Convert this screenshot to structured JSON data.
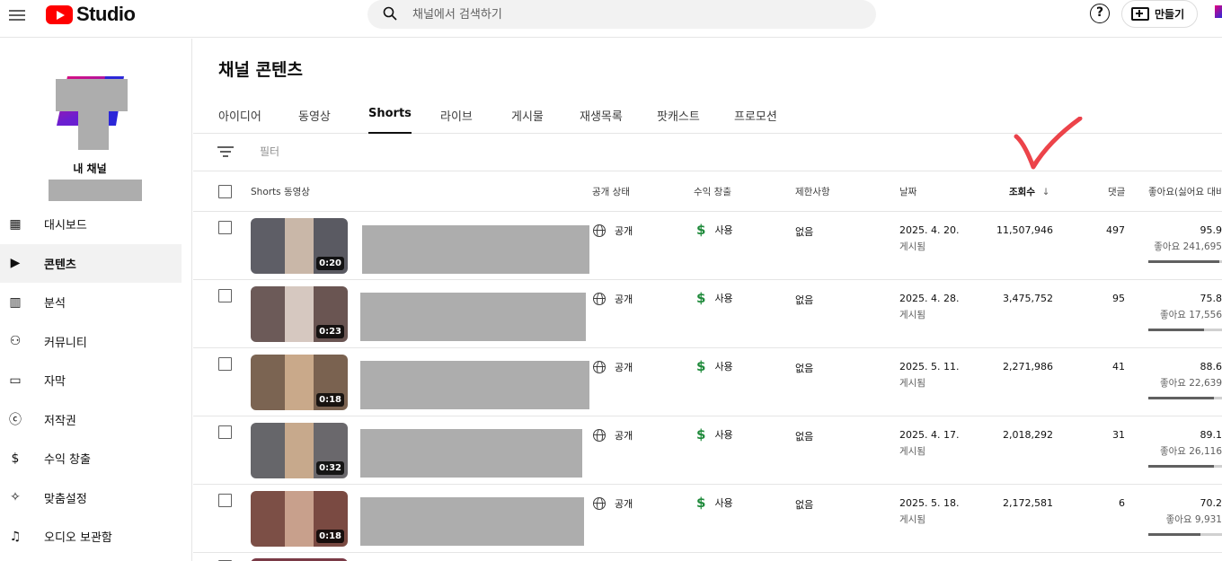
{
  "topbar": {
    "logo_text": "Studio",
    "search_placeholder": "채널에서 검색하기",
    "help_label": "?",
    "create_label": "만들기"
  },
  "sidebar": {
    "channel_label": "내 채널",
    "items": [
      {
        "label": "대시보드",
        "icon": "dashboard-icon",
        "glyph": "▦"
      },
      {
        "label": "콘텐츠",
        "icon": "content-icon",
        "glyph": "▶",
        "active": true
      },
      {
        "label": "분석",
        "icon": "analytics-icon",
        "glyph": "▥"
      },
      {
        "label": "커뮤니티",
        "icon": "community-icon",
        "glyph": "⚇"
      },
      {
        "label": "자막",
        "icon": "subtitles-icon",
        "glyph": "▭"
      },
      {
        "label": "저작권",
        "icon": "copyright-icon",
        "glyph": "ⓒ"
      },
      {
        "label": "수익 창출",
        "icon": "monetization-icon",
        "glyph": "$"
      },
      {
        "label": "맞춤설정",
        "icon": "customization-icon",
        "glyph": "✧"
      },
      {
        "label": "오디오 보관함",
        "icon": "audio-library-icon",
        "glyph": "♫"
      }
    ]
  },
  "main": {
    "title": "채널 콘텐츠",
    "tabs": [
      "아이디어",
      "동영상",
      "Shorts",
      "라이브",
      "게시물",
      "재생목록",
      "팟캐스트",
      "프로모션"
    ],
    "active_tab": "Shorts",
    "filter_placeholder": "필터",
    "columns": {
      "video": "Shorts 동영상",
      "visibility": "공개 상태",
      "monetization": "수익 창출",
      "restrictions": "제한사항",
      "date": "날짜",
      "views": "조회수",
      "views_sort": "↓",
      "comments": "댓글",
      "likes": "좋아요(싫어요 대비"
    },
    "rows": [
      {
        "duration": "0:20",
        "visibility": "공개",
        "monetization": "사용",
        "restrictions": "없음",
        "date": "2025. 4. 20.",
        "date_status": "게시됨",
        "views": "11,507,946",
        "comments": "497",
        "likes_pct": "95.9",
        "likes_count": "좋아요 241,695",
        "likes_ratio": 0.959
      },
      {
        "duration": "0:23",
        "visibility": "공개",
        "monetization": "사용",
        "restrictions": "없음",
        "date": "2025. 4. 28.",
        "date_status": "게시됨",
        "views": "3,475,752",
        "comments": "95",
        "likes_pct": "75.8",
        "likes_count": "좋아요 17,556",
        "likes_ratio": 0.758
      },
      {
        "duration": "0:18",
        "visibility": "공개",
        "monetization": "사용",
        "restrictions": "없음",
        "date": "2025. 5. 11.",
        "date_status": "게시됨",
        "views": "2,271,986",
        "comments": "41",
        "likes_pct": "88.6",
        "likes_count": "좋아요 22,639",
        "likes_ratio": 0.886
      },
      {
        "duration": "0:32",
        "visibility": "공개",
        "monetization": "사용",
        "restrictions": "없음",
        "date": "2025. 4. 17.",
        "date_status": "게시됨",
        "views": "2,018,292",
        "comments": "31",
        "likes_pct": "89.1",
        "likes_count": "좋아요 26,116",
        "likes_ratio": 0.891
      },
      {
        "duration": "0:18",
        "visibility": "공개",
        "monetization": "사용",
        "restrictions": "없음",
        "date": "2025. 5. 18.",
        "date_status": "게시됨",
        "views": "2,172,581",
        "comments": "6",
        "likes_pct": "70.2",
        "likes_count": "좋아요 9,931",
        "likes_ratio": 0.702
      }
    ]
  },
  "colors": {
    "youtube_red": "#ff0000",
    "monetization_green": "#1f8a3b",
    "annotation_red": "#e8202a",
    "redaction_gray": "#adadad"
  }
}
